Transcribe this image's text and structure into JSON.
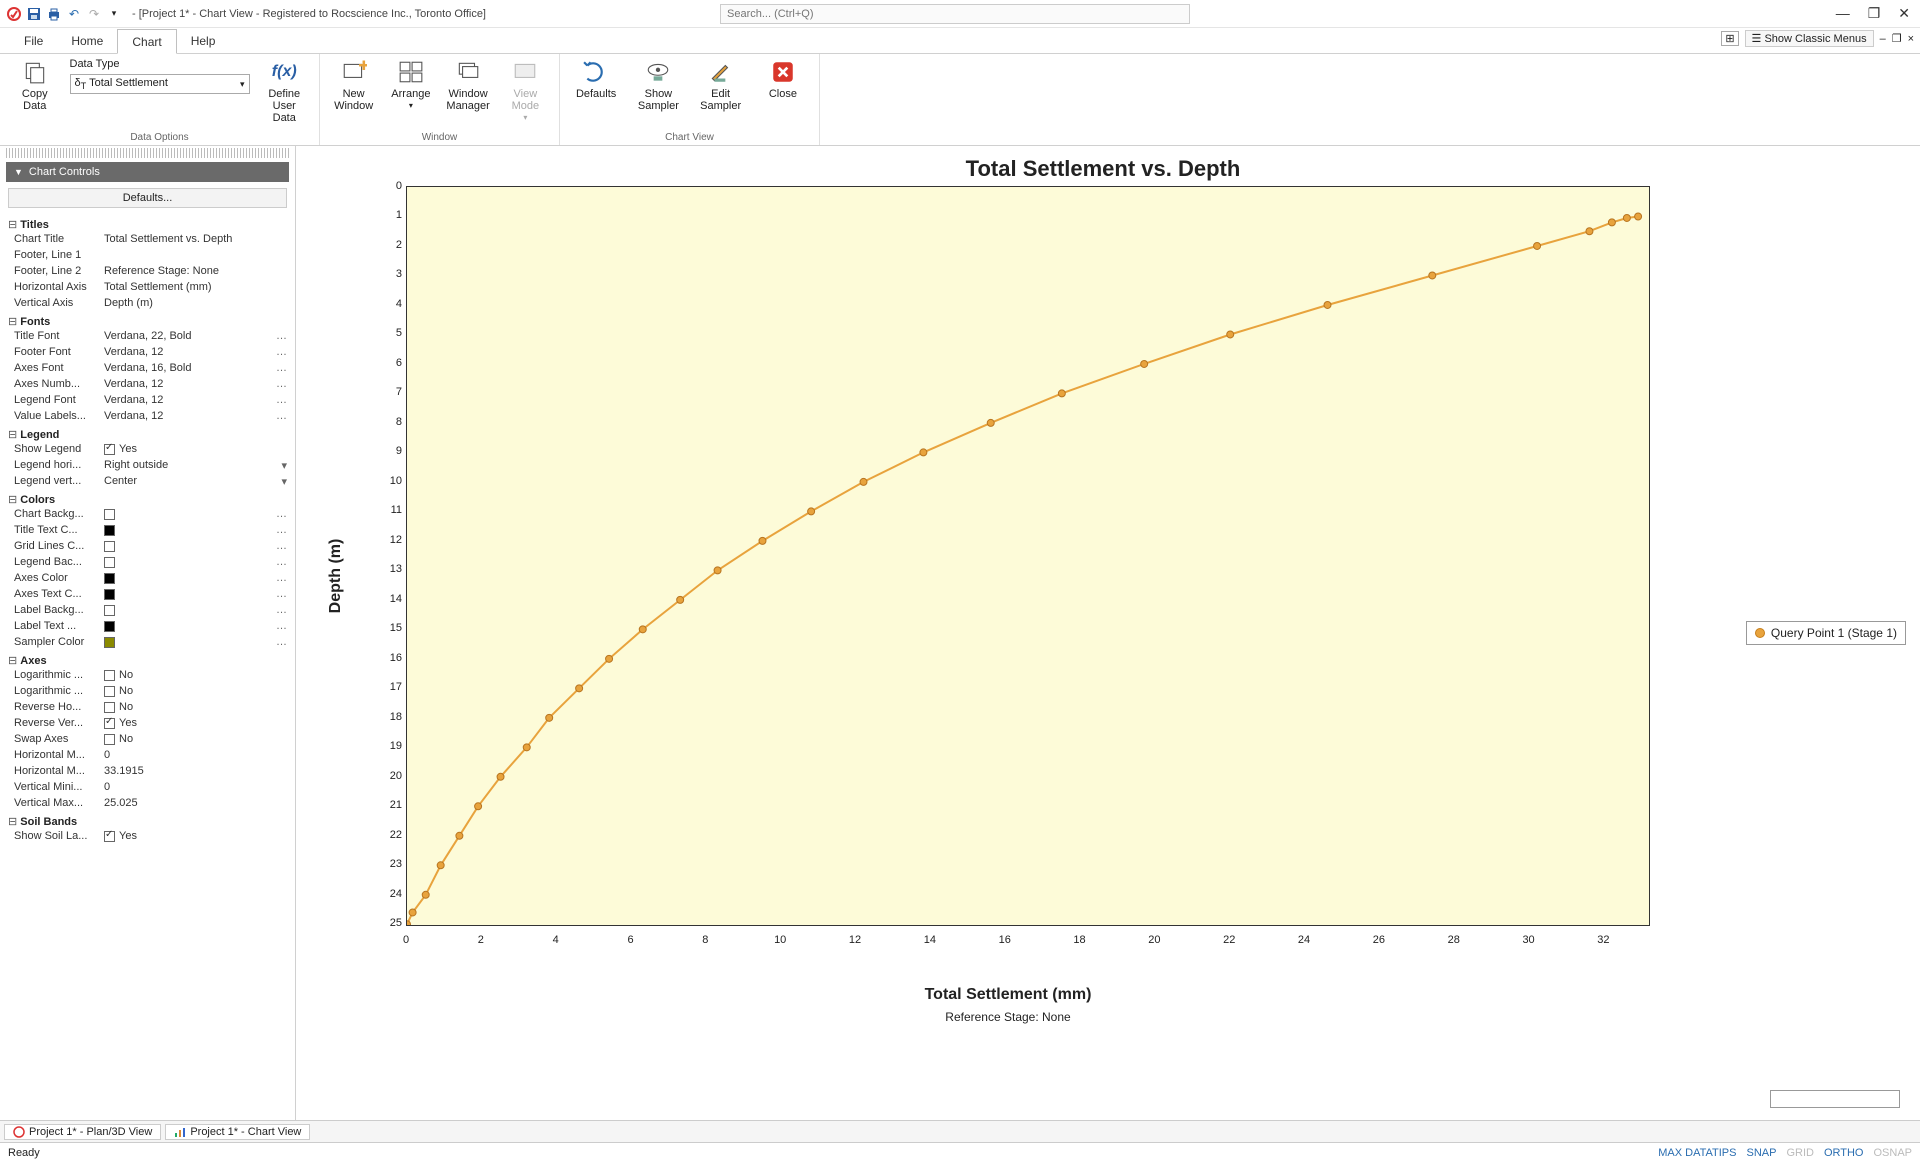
{
  "window": {
    "title": "- [Project 1* - Chart View - Registered to Rocscience Inc., Toronto Office]",
    "search_placeholder": "Search... (Ctrl+Q)",
    "classic_menus": "Show Classic Menus"
  },
  "menu": {
    "file": "File",
    "home": "Home",
    "chart": "Chart",
    "help": "Help"
  },
  "ribbon": {
    "copy_data": "Copy\nData",
    "data_type_label": "Data Type",
    "data_type_value": "Total Settlement",
    "define_user_data": "Define\nUser Data",
    "group_data_options": "Data Options",
    "new_window": "New\nWindow",
    "arrange": "Arrange",
    "window_manager": "Window\nManager",
    "view_mode": "View\nMode",
    "group_window": "Window",
    "defaults": "Defaults",
    "show_sampler": "Show\nSampler",
    "edit_sampler": "Edit\nSampler",
    "close": "Close",
    "group_chart_view": "Chart View"
  },
  "panel": {
    "title": "Chart Controls",
    "defaults_btn": "Defaults...",
    "groups": {
      "titles": "Titles",
      "fonts": "Fonts",
      "legend": "Legend",
      "colors": "Colors",
      "axes": "Axes",
      "soil": "Soil Bands"
    },
    "titles": {
      "chart_title_k": "Chart Title",
      "chart_title_v": "Total Settlement vs. Depth",
      "footer1_k": "Footer, Line 1",
      "footer1_v": "",
      "footer2_k": "Footer, Line 2",
      "footer2_v": "Reference Stage: None",
      "haxis_k": "Horizontal Axis",
      "haxis_v": "Total Settlement (mm)",
      "vaxis_k": "Vertical Axis",
      "vaxis_v": "Depth (m)"
    },
    "fonts": {
      "title_k": "Title Font",
      "title_v": "Verdana, 22, Bold",
      "footer_k": "Footer Font",
      "footer_v": "Verdana, 12",
      "axes_k": "Axes Font",
      "axes_v": "Verdana, 16, Bold",
      "axesnum_k": "Axes Numb...",
      "axesnum_v": "Verdana, 12",
      "legend_k": "Legend Font",
      "legend_v": "Verdana, 12",
      "valuelab_k": "Value Labels...",
      "valuelab_v": "Verdana, 12"
    },
    "legend": {
      "show_k": "Show Legend",
      "show_v": "Yes",
      "horiz_k": "Legend hori...",
      "horiz_v": "Right outside",
      "vert_k": "Legend vert...",
      "vert_v": "Center"
    },
    "colors": {
      "bg_k": "Chart Backg...",
      "titlec_k": "Title Text C...",
      "grid_k": "Grid Lines C...",
      "legendbg_k": "Legend Bac...",
      "axesc_k": "Axes Color",
      "axestxt_k": "Axes Text C...",
      "labelbg_k": "Label Backg...",
      "labeltxt_k": "Label Text ...",
      "sampler_k": "Sampler Color"
    },
    "axes": {
      "logx_k": "Logarithmic ...",
      "logx_v": "No",
      "logy_k": "Logarithmic ...",
      "logy_v": "No",
      "revh_k": "Reverse Ho...",
      "revh_v": "No",
      "revv_k": "Reverse Ver...",
      "revv_v": "Yes",
      "swap_k": "Swap Axes",
      "swap_v": "No",
      "hmin_k": "Horizontal M...",
      "hmin_v": "0",
      "hmax_k": "Horizontal M...",
      "hmax_v": "33.1915",
      "vmin_k": "Vertical Mini...",
      "vmin_v": "0",
      "vmax_k": "Vertical Max...",
      "vmax_v": "25.025"
    },
    "soil": {
      "show_k": "Show Soil La...",
      "show_v": "Yes"
    }
  },
  "chart_data": {
    "type": "line",
    "title": "Total Settlement vs. Depth",
    "xlabel": "Total Settlement (mm)",
    "ylabel": "Depth (m)",
    "footer2": "Reference Stage: None",
    "xlim": [
      0,
      33.1915
    ],
    "ylim": [
      0,
      25.025
    ],
    "y_reversed": true,
    "x_ticks": [
      0,
      2,
      4,
      6,
      8,
      10,
      12,
      14,
      16,
      18,
      20,
      22,
      24,
      26,
      28,
      30,
      32
    ],
    "y_ticks": [
      0,
      1,
      2,
      3,
      4,
      5,
      6,
      7,
      8,
      9,
      10,
      11,
      12,
      13,
      14,
      15,
      16,
      17,
      18,
      19,
      20,
      21,
      22,
      23,
      24,
      25
    ],
    "series": [
      {
        "name": "Query Point 1 (Stage 1)",
        "color": "#e8a33d",
        "points": [
          {
            "x": 0.0,
            "y": 25.0
          },
          {
            "x": 0.15,
            "y": 24.6
          },
          {
            "x": 0.5,
            "y": 24.0
          },
          {
            "x": 0.9,
            "y": 23.0
          },
          {
            "x": 1.4,
            "y": 22.0
          },
          {
            "x": 1.9,
            "y": 21.0
          },
          {
            "x": 2.5,
            "y": 20.0
          },
          {
            "x": 3.2,
            "y": 19.0
          },
          {
            "x": 3.8,
            "y": 18.0
          },
          {
            "x": 4.6,
            "y": 17.0
          },
          {
            "x": 5.4,
            "y": 16.0
          },
          {
            "x": 6.3,
            "y": 15.0
          },
          {
            "x": 7.3,
            "y": 14.0
          },
          {
            "x": 8.3,
            "y": 13.0
          },
          {
            "x": 9.5,
            "y": 12.0
          },
          {
            "x": 10.8,
            "y": 11.0
          },
          {
            "x": 12.2,
            "y": 10.0
          },
          {
            "x": 13.8,
            "y": 9.0
          },
          {
            "x": 15.6,
            "y": 8.0
          },
          {
            "x": 17.5,
            "y": 7.0
          },
          {
            "x": 19.7,
            "y": 6.0
          },
          {
            "x": 22.0,
            "y": 5.0
          },
          {
            "x": 24.6,
            "y": 4.0
          },
          {
            "x": 27.4,
            "y": 3.0
          },
          {
            "x": 30.2,
            "y": 2.0
          },
          {
            "x": 31.6,
            "y": 1.5
          },
          {
            "x": 32.2,
            "y": 1.2
          },
          {
            "x": 32.6,
            "y": 1.05
          },
          {
            "x": 32.9,
            "y": 1.0
          }
        ]
      }
    ],
    "legend": {
      "position": "right-outside",
      "items": [
        "Query Point 1 (Stage 1)"
      ]
    }
  },
  "doctabs": {
    "tab1": "Project 1* - Plan/3D View",
    "tab2": "Project 1* - Chart View"
  },
  "status": {
    "ready": "Ready",
    "maxdata": "MAX DATATIPS",
    "snap": "SNAP",
    "grid": "GRID",
    "ortho": "ORTHO",
    "osnap": "OSNAP"
  }
}
